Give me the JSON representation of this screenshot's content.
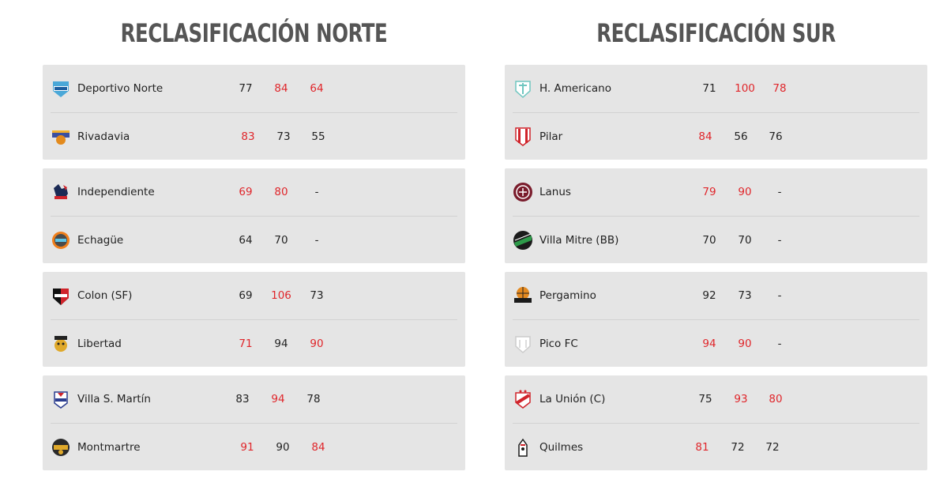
{
  "norte": {
    "title": "RECLASIFICACIÓN NORTE",
    "series": [
      {
        "teams": [
          {
            "name": "Deportivo Norte",
            "logo": "deportivo-norte-logo",
            "scores": [
              {
                "v": "77",
                "win": false
              },
              {
                "v": "84",
                "win": true
              },
              {
                "v": "64",
                "win": true
              }
            ]
          },
          {
            "name": "Rivadavia",
            "logo": "rivadavia-logo",
            "scores": [
              {
                "v": "83",
                "win": true
              },
              {
                "v": "73",
                "win": false
              },
              {
                "v": "55",
                "win": false
              }
            ]
          }
        ]
      },
      {
        "teams": [
          {
            "name": "Independiente",
            "logo": "independiente-logo",
            "scores": [
              {
                "v": "69",
                "win": true
              },
              {
                "v": "80",
                "win": true
              },
              {
                "v": "-",
                "win": false
              }
            ]
          },
          {
            "name": "Echagüe",
            "logo": "echague-logo",
            "scores": [
              {
                "v": "64",
                "win": false
              },
              {
                "v": "70",
                "win": false
              },
              {
                "v": "-",
                "win": false
              }
            ]
          }
        ]
      },
      {
        "teams": [
          {
            "name": "Colon (SF)",
            "logo": "colon-logo",
            "scores": [
              {
                "v": "69",
                "win": false
              },
              {
                "v": "106",
                "win": true
              },
              {
                "v": "73",
                "win": false
              }
            ]
          },
          {
            "name": "Libertad",
            "logo": "libertad-logo",
            "scores": [
              {
                "v": "71",
                "win": true
              },
              {
                "v": "94",
                "win": false
              },
              {
                "v": "90",
                "win": true
              }
            ]
          }
        ]
      },
      {
        "teams": [
          {
            "name": "Villa S. Martín",
            "logo": "villa-san-martin-logo",
            "scores": [
              {
                "v": "83",
                "win": false
              },
              {
                "v": "94",
                "win": true
              },
              {
                "v": "78",
                "win": false
              }
            ]
          },
          {
            "name": "Montmartre",
            "logo": "montmartre-logo",
            "scores": [
              {
                "v": "91",
                "win": true
              },
              {
                "v": "90",
                "win": false
              },
              {
                "v": "84",
                "win": true
              }
            ]
          }
        ]
      }
    ]
  },
  "sur": {
    "title": "RECLASIFICACIÓN SUR",
    "series": [
      {
        "teams": [
          {
            "name": "H. Americano",
            "logo": "h-americano-logo",
            "scores": [
              {
                "v": "71",
                "win": false
              },
              {
                "v": "100",
                "win": true
              },
              {
                "v": "78",
                "win": true
              }
            ]
          },
          {
            "name": "Pilar",
            "logo": "pilar-logo",
            "scores": [
              {
                "v": "84",
                "win": true
              },
              {
                "v": "56",
                "win": false
              },
              {
                "v": "76",
                "win": false
              }
            ]
          }
        ]
      },
      {
        "teams": [
          {
            "name": "Lanus",
            "logo": "lanus-logo",
            "scores": [
              {
                "v": "79",
                "win": true
              },
              {
                "v": "90",
                "win": true
              },
              {
                "v": "-",
                "win": false
              }
            ]
          },
          {
            "name": "Villa Mitre (BB)",
            "logo": "villa-mitre-logo",
            "scores": [
              {
                "v": "70",
                "win": false
              },
              {
                "v": "70",
                "win": false
              },
              {
                "v": "-",
                "win": false
              }
            ]
          }
        ]
      },
      {
        "teams": [
          {
            "name": "Pergamino",
            "logo": "pergamino-logo",
            "scores": [
              {
                "v": "92",
                "win": false
              },
              {
                "v": "73",
                "win": false
              },
              {
                "v": "-",
                "win": false
              }
            ]
          },
          {
            "name": "Pico FC",
            "logo": "pico-fc-logo",
            "scores": [
              {
                "v": "94",
                "win": true
              },
              {
                "v": "90",
                "win": true
              },
              {
                "v": "-",
                "win": false
              }
            ]
          }
        ]
      },
      {
        "teams": [
          {
            "name": "La Unión (C)",
            "logo": "la-union-logo",
            "scores": [
              {
                "v": "75",
                "win": false
              },
              {
                "v": "93",
                "win": true
              },
              {
                "v": "80",
                "win": true
              }
            ]
          },
          {
            "name": "Quilmes",
            "logo": "quilmes-logo",
            "scores": [
              {
                "v": "81",
                "win": true
              },
              {
                "v": "72",
                "win": false
              },
              {
                "v": "72",
                "win": false
              }
            ]
          }
        ]
      }
    ]
  }
}
